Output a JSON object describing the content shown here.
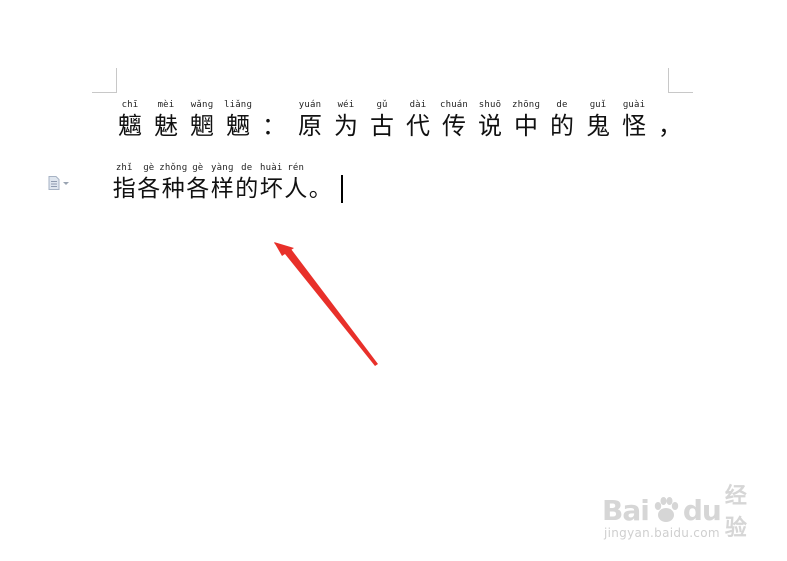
{
  "document": {
    "line1": [
      {
        "pinyin": "chī",
        "char": "魑"
      },
      {
        "pinyin": "mèi",
        "char": "魅"
      },
      {
        "pinyin": "wǎnɡ",
        "char": "魍"
      },
      {
        "pinyin": "liǎnɡ",
        "char": "魉"
      },
      {
        "pinyin": "",
        "char": "："
      },
      {
        "pinyin": "yuán",
        "char": "原"
      },
      {
        "pinyin": "wéi",
        "char": "为"
      },
      {
        "pinyin": "ɡǔ",
        "char": "古"
      },
      {
        "pinyin": "dài",
        "char": "代"
      },
      {
        "pinyin": "chuán",
        "char": "传"
      },
      {
        "pinyin": "shuō",
        "char": "说"
      },
      {
        "pinyin": "zhōnɡ",
        "char": "中"
      },
      {
        "pinyin": "de",
        "char": "的"
      },
      {
        "pinyin": "ɡuǐ",
        "char": "鬼"
      },
      {
        "pinyin": "ɡuài",
        "char": "怪"
      },
      {
        "pinyin": "",
        "char": "，"
      }
    ],
    "line2": [
      {
        "pinyin": "zhǐ",
        "char": "指"
      },
      {
        "pinyin": "ɡè",
        "char": "各"
      },
      {
        "pinyin": "zhǒnɡ",
        "char": "种"
      },
      {
        "pinyin": "ɡè",
        "char": "各"
      },
      {
        "pinyin": "yànɡ",
        "char": "样"
      },
      {
        "pinyin": "de",
        "char": "的"
      },
      {
        "pinyin": "huài",
        "char": "坏"
      },
      {
        "pinyin": "rén",
        "char": "人"
      },
      {
        "pinyin": "",
        "char": "。"
      }
    ]
  },
  "icons": {
    "paragraph_handle": "document-icon",
    "annotation": "red-arrow-icon",
    "watermark_logo": "baidu-paw-icon"
  },
  "watermark": {
    "brand_left": "Bai",
    "brand_right": "du",
    "brand_cn": "经验",
    "url": "jingyan.baidu.com"
  },
  "colors": {
    "arrow": "#e8302a",
    "watermark": "#d6d6d6",
    "text": "#111111"
  }
}
